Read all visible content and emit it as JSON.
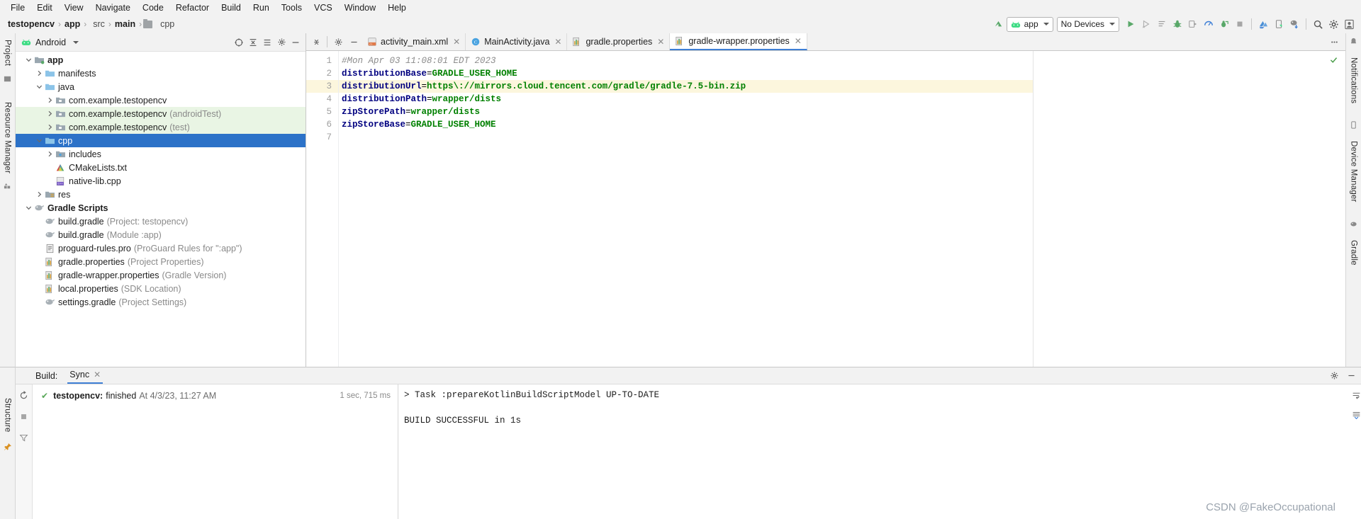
{
  "menu": {
    "items": [
      "File",
      "Edit",
      "View",
      "Navigate",
      "Code",
      "Refactor",
      "Build",
      "Run",
      "Tools",
      "VCS",
      "Window",
      "Help"
    ]
  },
  "breadcrumb": {
    "items": [
      "testopencv",
      "app",
      "src",
      "main",
      "cpp"
    ],
    "separator": "›"
  },
  "toolbar": {
    "run_config": "app",
    "device": "No Devices",
    "run_tooltip": "Run",
    "icons": [
      "make-project-icon",
      "android-icon",
      "run-icon",
      "apply-changes-icon",
      "apply-code-changes-icon",
      "debug-icon",
      "run-with-coverage-icon",
      "profiler-icon",
      "attach-debugger-icon",
      "stop-icon",
      "sdk-manager-icon",
      "avd-manager-icon",
      "sync-gradle-icon",
      "search-icon",
      "gear-icon",
      "avatar-icon"
    ]
  },
  "left_strip": {
    "tabs": [
      "Project",
      "Resource Manager"
    ],
    "bottom_tabs": [
      "Structure",
      "Favorites"
    ]
  },
  "right_strip": {
    "tabs": [
      "Notifications",
      "Device Manager",
      "Gradle"
    ]
  },
  "project_panel": {
    "title": "Android",
    "header_icons": [
      "select-opened-file-icon",
      "collapse-all-icon",
      "expand-icon",
      "settings-icon",
      "hide-icon"
    ],
    "tree": [
      {
        "label": "app",
        "detail": "",
        "depth": 0,
        "arrow": "down",
        "icon": "module-icon",
        "bold": true,
        "state": "normal"
      },
      {
        "label": "manifests",
        "detail": "",
        "depth": 1,
        "arrow": "right",
        "icon": "folder-icon",
        "bold": false,
        "state": "normal"
      },
      {
        "label": "java",
        "detail": "",
        "depth": 1,
        "arrow": "down",
        "icon": "folder-icon",
        "bold": false,
        "state": "normal"
      },
      {
        "label": "com.example.testopencv",
        "detail": "",
        "depth": 2,
        "arrow": "right",
        "icon": "package-icon",
        "bold": false,
        "state": "normal"
      },
      {
        "label": "com.example.testopencv",
        "detail": "(androidTest)",
        "depth": 2,
        "arrow": "right",
        "icon": "package-icon",
        "bold": false,
        "state": "green"
      },
      {
        "label": "com.example.testopencv",
        "detail": "(test)",
        "depth": 2,
        "arrow": "right",
        "icon": "package-icon",
        "bold": false,
        "state": "green"
      },
      {
        "label": "cpp",
        "detail": "",
        "depth": 1,
        "arrow": "down",
        "icon": "folder-icon",
        "bold": false,
        "state": "selected"
      },
      {
        "label": "includes",
        "detail": "",
        "depth": 2,
        "arrow": "right",
        "icon": "includes-icon",
        "bold": false,
        "state": "normal"
      },
      {
        "label": "CMakeLists.txt",
        "detail": "",
        "depth": 2,
        "arrow": "none",
        "icon": "cmake-icon",
        "bold": false,
        "state": "normal"
      },
      {
        "label": "native-lib.cpp",
        "detail": "",
        "depth": 2,
        "arrow": "none",
        "icon": "cpp-file-icon",
        "bold": false,
        "state": "normal"
      },
      {
        "label": "res",
        "detail": "",
        "depth": 1,
        "arrow": "right",
        "icon": "res-folder-icon",
        "bold": false,
        "state": "normal"
      },
      {
        "label": "Gradle Scripts",
        "detail": "",
        "depth": 0,
        "arrow": "down",
        "icon": "gradle-icon",
        "bold": true,
        "state": "normal"
      },
      {
        "label": "build.gradle",
        "detail": "(Project: testopencv)",
        "depth": 1,
        "arrow": "none",
        "icon": "gradle-icon",
        "bold": false,
        "state": "normal"
      },
      {
        "label": "build.gradle",
        "detail": "(Module :app)",
        "depth": 1,
        "arrow": "none",
        "icon": "gradle-icon",
        "bold": false,
        "state": "normal"
      },
      {
        "label": "proguard-rules.pro",
        "detail": "(ProGuard Rules for \":app\")",
        "depth": 1,
        "arrow": "none",
        "icon": "text-file-icon",
        "bold": false,
        "state": "normal"
      },
      {
        "label": "gradle.properties",
        "detail": "(Project Properties)",
        "depth": 1,
        "arrow": "none",
        "icon": "properties-icon",
        "bold": false,
        "state": "normal"
      },
      {
        "label": "gradle-wrapper.properties",
        "detail": "(Gradle Version)",
        "depth": 1,
        "arrow": "none",
        "icon": "properties-icon",
        "bold": false,
        "state": "normal"
      },
      {
        "label": "local.properties",
        "detail": "(SDK Location)",
        "depth": 1,
        "arrow": "none",
        "icon": "properties-icon",
        "bold": false,
        "state": "normal"
      },
      {
        "label": "settings.gradle",
        "detail": "(Project Settings)",
        "depth": 1,
        "arrow": "none",
        "icon": "gradle-icon",
        "bold": false,
        "state": "normal"
      }
    ]
  },
  "editor": {
    "tabs": [
      {
        "label": "activity_main.xml",
        "icon": "xml-layout-icon",
        "active": false
      },
      {
        "label": "MainActivity.java",
        "icon": "java-class-icon",
        "active": false
      },
      {
        "label": "gradle.properties",
        "icon": "properties-icon",
        "active": false
      },
      {
        "label": "gradle-wrapper.properties",
        "icon": "properties-icon",
        "active": true
      }
    ],
    "line_numbers": [
      "1",
      "2",
      "3",
      "4",
      "5",
      "6",
      "7"
    ],
    "highlight_line": 3,
    "inspection_status": "ok",
    "lines": [
      {
        "comment": "#Mon Apr 03 11:08:01 EDT 2023",
        "key": "",
        "value": ""
      },
      {
        "comment": "",
        "key": "distributionBase",
        "value": "GRADLE_USER_HOME"
      },
      {
        "comment": "",
        "key": "distributionUrl",
        "value": "https\\://mirrors.cloud.tencent.com/gradle/gradle-7.5-bin.zip"
      },
      {
        "comment": "",
        "key": "distributionPath",
        "value": "wrapper/dists"
      },
      {
        "comment": "",
        "key": "zipStorePath",
        "value": "wrapper/dists"
      },
      {
        "comment": "",
        "key": "zipStoreBase",
        "value": "GRADLE_USER_HOME"
      },
      {
        "comment": "",
        "key": "",
        "value": ""
      }
    ]
  },
  "build_panel": {
    "label": "Build:",
    "tab": "Sync",
    "tree_row": {
      "check": "✔",
      "name": "testopencv:",
      "status": "finished",
      "at": "At 4/3/23, 11:27 AM",
      "duration": "1 sec, 715 ms"
    },
    "output": [
      "> Task :prepareKotlinBuildScriptModel UP-TO-DATE",
      "",
      "BUILD SUCCESSFUL in 1s"
    ],
    "icons": [
      "rerun-icon",
      "stop-icon",
      "filter-icon",
      "settings-icon",
      "hide-icon",
      "soft-wrap-icon",
      "scroll-to-end-icon"
    ]
  },
  "watermark": "CSDN @FakeOccupational",
  "colors": {
    "selection_blue": "#2c72c8",
    "test_green_row": "#e9f5e4",
    "highlight_yellow": "#fcf6dd",
    "key_navy": "#000080",
    "value_green": "#008000",
    "comment_gray": "#8c8c8c",
    "accent_green": "#4a9e4a",
    "panel_bg": "#f2f2f2"
  }
}
